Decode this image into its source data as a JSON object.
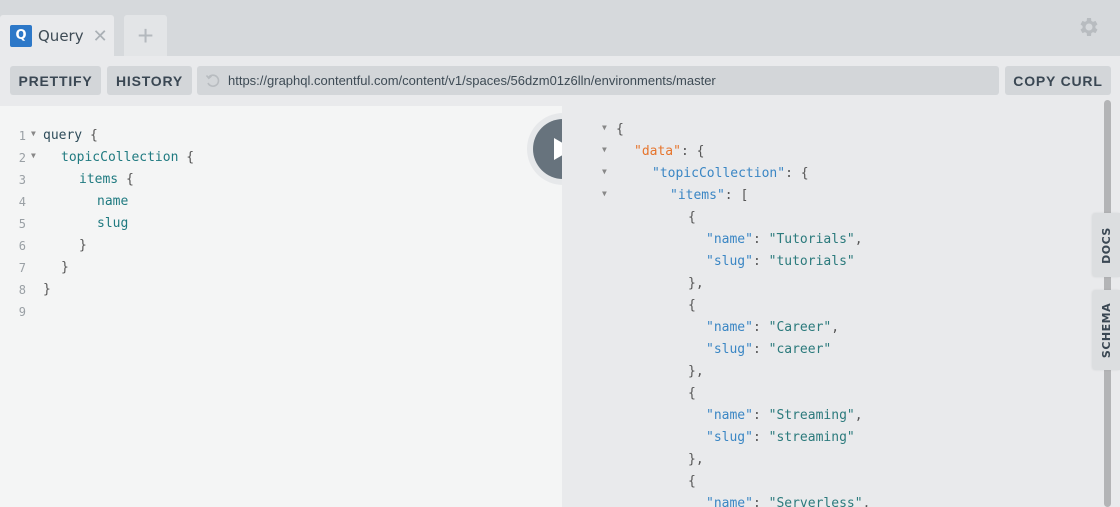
{
  "tabs": [
    {
      "badge": "Q",
      "title": "Query",
      "close_icon": "close-icon"
    }
  ],
  "add_tab_label": "+",
  "toolbar": {
    "prettify_label": "PRETTIFY",
    "history_label": "HISTORY",
    "endpoint_url": "https://graphql.contentful.com/content/v1/spaces/56dzm01z6lln/environments/master",
    "copy_curl_label": "COPY CURL"
  },
  "editor": {
    "line_numbers": [
      "1",
      "2",
      "3",
      "4",
      "5",
      "6",
      "7",
      "8",
      "9"
    ],
    "lines": [
      {
        "keyword": "query",
        "field": "",
        "punc": " {"
      },
      {
        "keyword": "",
        "field": "topicCollection",
        "punc": " {"
      },
      {
        "keyword": "",
        "field": "items",
        "punc": " {"
      },
      {
        "keyword": "",
        "field": "name",
        "punc": ""
      },
      {
        "keyword": "",
        "field": "slug",
        "punc": ""
      },
      {
        "keyword": "",
        "field": "",
        "punc": "}"
      },
      {
        "keyword": "",
        "field": "",
        "punc": "}"
      },
      {
        "keyword": "",
        "field": "",
        "punc": "}"
      },
      {
        "keyword": "",
        "field": "",
        "punc": ""
      }
    ]
  },
  "result": {
    "open_brace": "{",
    "data_key": "\"data\"",
    "collection_key": "\"topicCollection\"",
    "items_key": "\"items\"",
    "name_key": "\"name\"",
    "slug_key": "\"slug\"",
    "items": [
      {
        "name": "\"Tutorials\"",
        "slug": "\"tutorials\""
      },
      {
        "name": "\"Career\"",
        "slug": "\"career\""
      },
      {
        "name": "\"Streaming\"",
        "slug": "\"streaming\""
      },
      {
        "name": "\"Serverless\"",
        "slug": ""
      }
    ]
  },
  "side_tabs": {
    "docs": "DOCS",
    "schema": "SCHEMA"
  }
}
